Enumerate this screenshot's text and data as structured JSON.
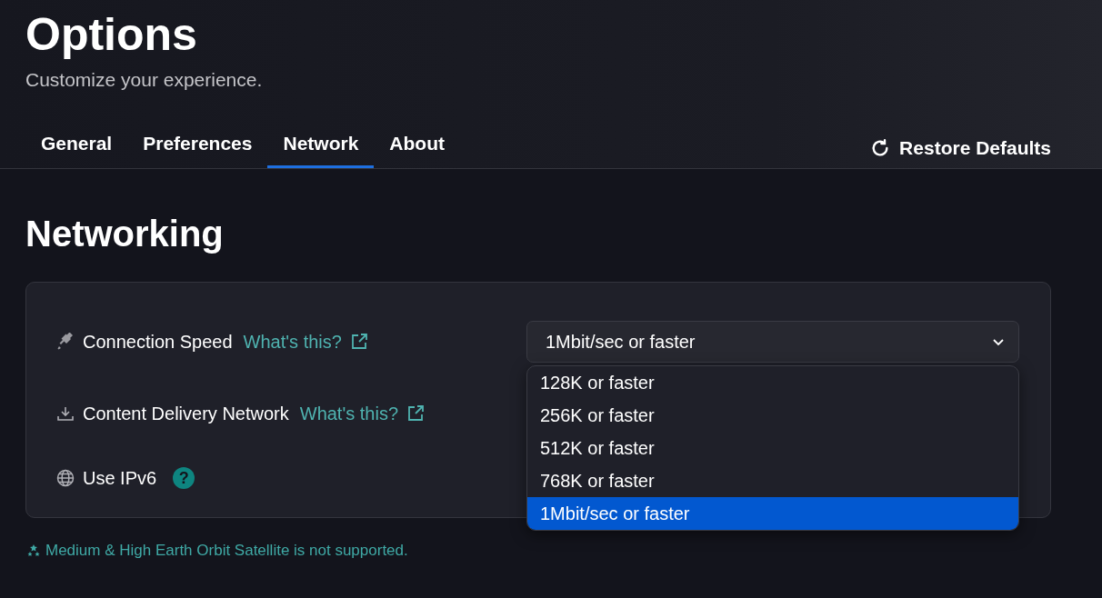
{
  "header": {
    "title": "Options",
    "subtitle": "Customize your experience."
  },
  "tabs": [
    {
      "label": "General",
      "selected": false
    },
    {
      "label": "Preferences",
      "selected": false
    },
    {
      "label": "Network",
      "selected": true
    },
    {
      "label": "About",
      "selected": false
    }
  ],
  "restore_button": "Restore Defaults",
  "section_title": "Networking",
  "settings": [
    {
      "kind": "plug",
      "label": "Connection Speed",
      "link": "What's this?"
    },
    {
      "kind": "download",
      "label": "Content Delivery Network",
      "link": "What's this?"
    },
    {
      "kind": "globe",
      "label": "Use IPv6",
      "help": "?"
    }
  ],
  "speed_dropdown": {
    "value": "1Mbit/sec or faster",
    "expanded": true,
    "options": [
      {
        "label": "128K or faster",
        "selected": false
      },
      {
        "label": "256K or faster",
        "selected": false
      },
      {
        "label": "512K or faster",
        "selected": false
      },
      {
        "label": "768K or faster",
        "selected": false
      },
      {
        "label": "1Mbit/sec or faster",
        "selected": true
      }
    ]
  },
  "note": "Medium & High Earth Orbit Satellite is not supported."
}
